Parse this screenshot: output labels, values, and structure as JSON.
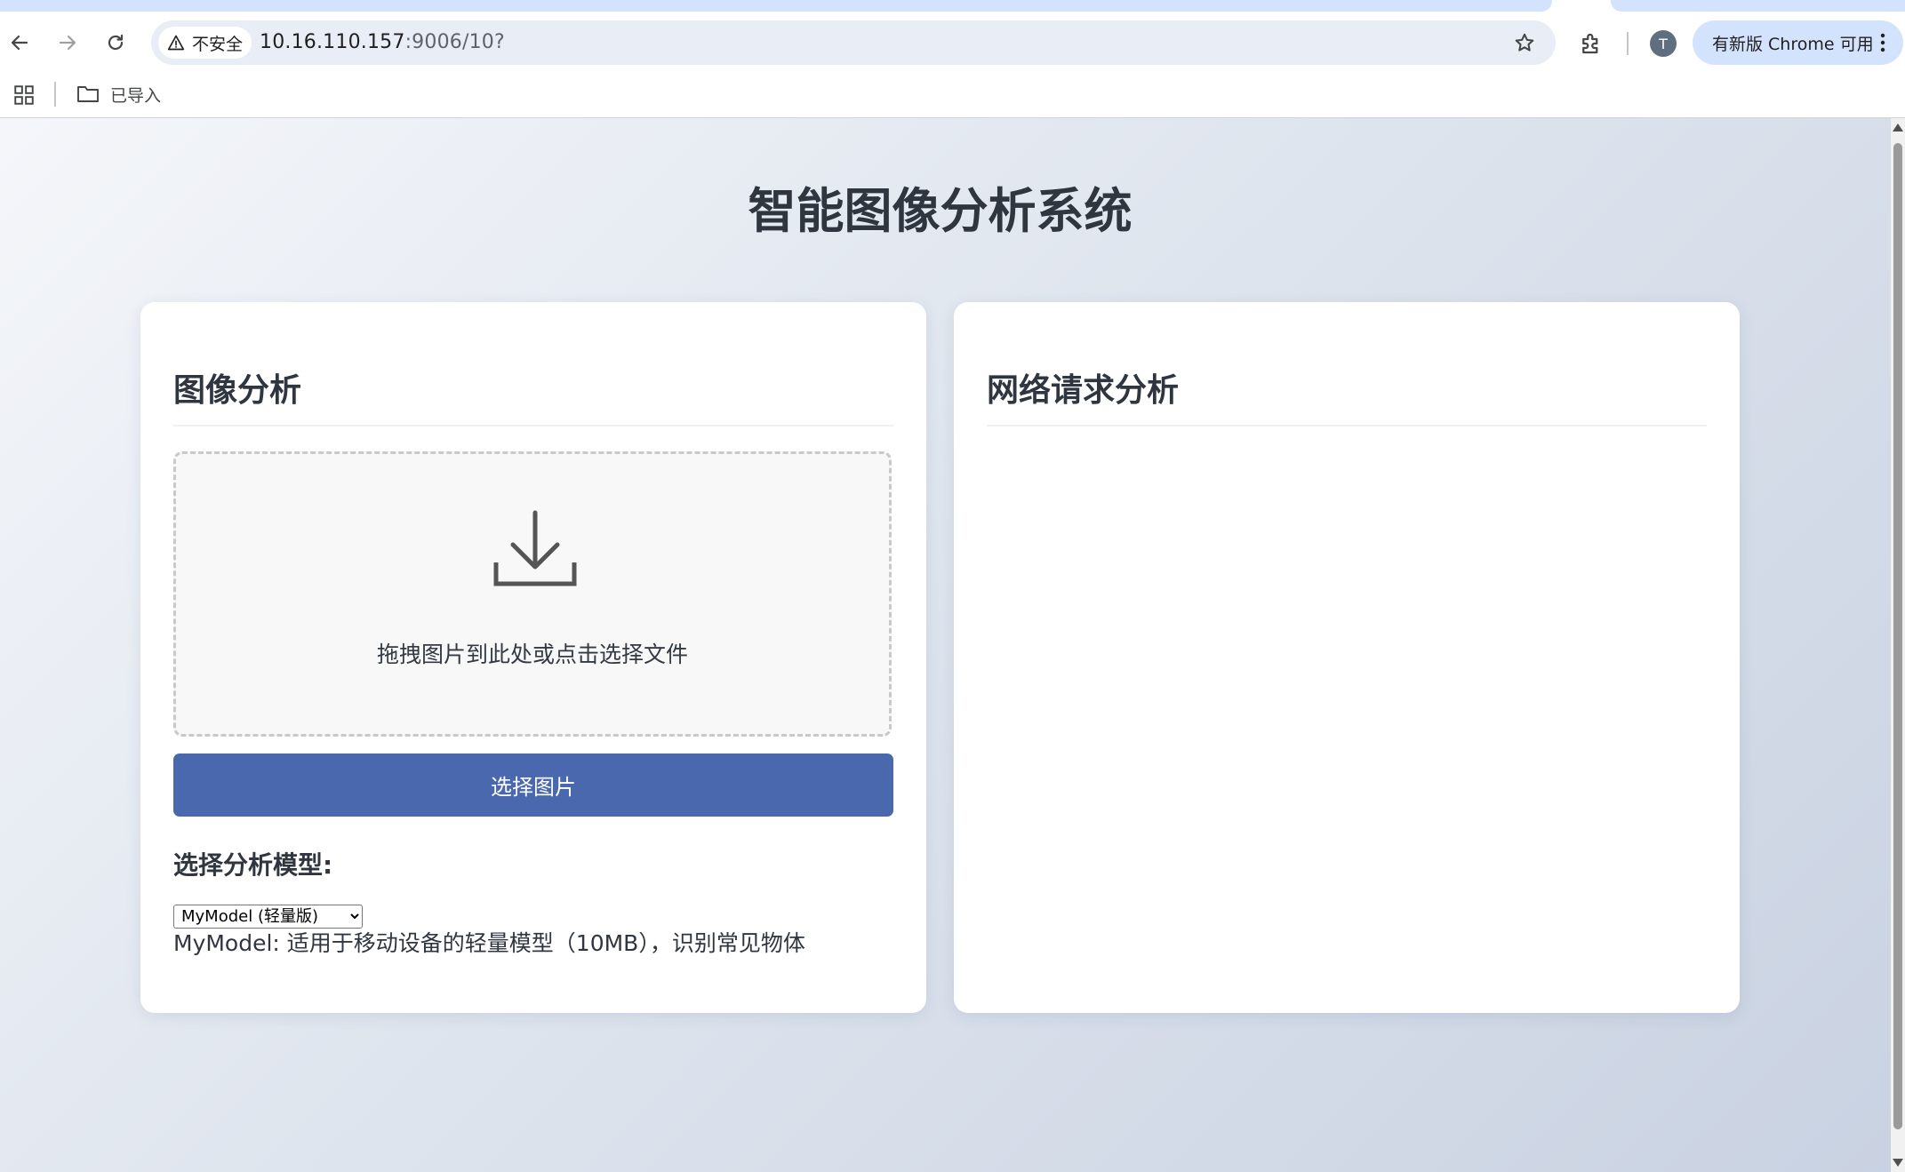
{
  "browser": {
    "security_label": "不安全",
    "url_host": "10.16.110.157",
    "url_rest": ":9006/10?",
    "profile_initial": "T",
    "update_label": "有新版 Chrome 可用",
    "bookmark_folder": "已导入"
  },
  "page": {
    "title": "智能图像分析系统",
    "image_panel": {
      "heading": "图像分析",
      "drop_hint": "拖拽图片到此处或点击选择文件",
      "choose_button": "选择图片",
      "model_label": "选择分析模型:",
      "model_selected": "MyModel (轻量版)",
      "model_description": "MyModel: 适用于移动设备的轻量模型（10MB），识别常见物体"
    },
    "network_panel": {
      "heading": "网络请求分析"
    }
  },
  "colors": {
    "primary_button": "#4a68ad",
    "heading_text": "#2f3640"
  }
}
